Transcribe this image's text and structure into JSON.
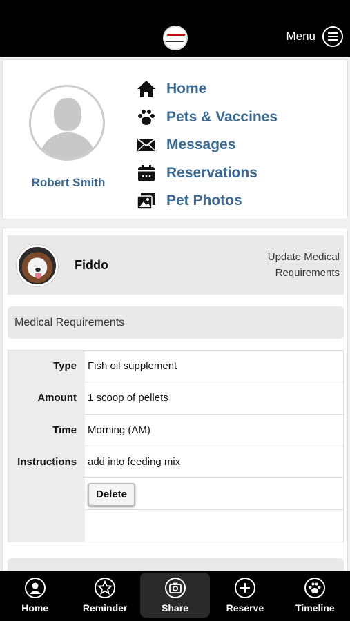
{
  "header": {
    "menu_label": "Menu"
  },
  "profile": {
    "name": "Robert Smith"
  },
  "nav": [
    {
      "label": "Home",
      "icon": "home-icon"
    },
    {
      "label": "Pets & Vaccines",
      "icon": "paw-icon"
    },
    {
      "label": "Messages",
      "icon": "envelope-icon"
    },
    {
      "label": "Reservations",
      "icon": "calendar-icon"
    },
    {
      "label": "Pet Photos",
      "icon": "photos-icon"
    }
  ],
  "pet": {
    "name": "Fiddo",
    "update_link": "Update Medical Requirements"
  },
  "section_title": "Medical Requirements",
  "requirements": [
    {
      "key": "Type",
      "value": "Fish oil supplement"
    },
    {
      "key": "Amount",
      "value": "1 scoop of pellets"
    },
    {
      "key": "Time",
      "value": "Morning (AM)"
    },
    {
      "key": "Instructions",
      "value": "add into feeding mix"
    }
  ],
  "delete_label": "Delete",
  "tabs": [
    {
      "label": "Home",
      "icon": "user-circle-icon"
    },
    {
      "label": "Reminder",
      "icon": "star-icon"
    },
    {
      "label": "Share",
      "icon": "camera-icon",
      "active": true
    },
    {
      "label": "Reserve",
      "icon": "plus-icon"
    },
    {
      "label": "Timeline",
      "icon": "paw-icon"
    }
  ]
}
